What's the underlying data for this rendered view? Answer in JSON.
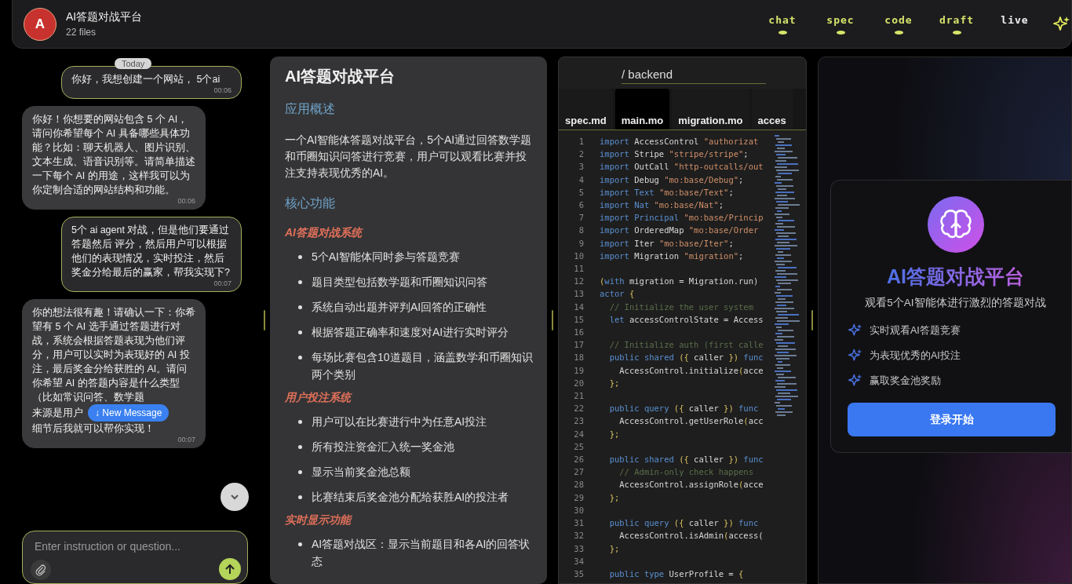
{
  "project": {
    "avatar": "A",
    "title": "AI答题对战平台",
    "subtitle": "22 files"
  },
  "tabs": [
    {
      "label": "chat",
      "selected": false,
      "dot": true
    },
    {
      "label": "spec",
      "selected": false,
      "dot": true
    },
    {
      "label": "code",
      "selected": false,
      "dot": true
    },
    {
      "label": "draft",
      "selected": false,
      "dot": true
    },
    {
      "label": "live",
      "selected": true,
      "dot": false
    }
  ],
  "chat": {
    "date_badge": "Today",
    "new_message": "↓ New Message",
    "input_placeholder": "Enter instruction or question...",
    "messages": [
      {
        "kind": "user",
        "text": "你好，我想创建一个网站， 5个ai",
        "time": "00:06"
      },
      {
        "kind": "assistant",
        "text": "你好！你想要的网站包含 5 个 AI，请问你希望每个 AI 具备哪些具体功能？比如：聊天机器人、图片识别、文本生成、语音识别等。请简单描述一下每个 AI 的用途，这样我可以为你定制合适的网站结构和功能。",
        "time": "00:06"
      },
      {
        "kind": "user",
        "text": "5个 ai agent 对战，但是他们要通过答题然后 评分，然后用户可以根据他们的表现情况，实时投注，然后奖金分给最后的赢家，帮我实现下?",
        "time": "00:07"
      },
      {
        "kind": "assistant",
        "text": "你的想法很有趣！请确认一下：你希望有 5 个 AI 选手通过答题进行对战，系统会根据答题表现为他们评分，用户可以实时为表现好的 AI 投注，最后奖金分给获胜的 AI。请问你希望 AI 的答题内容是什么类型（比如常识问答、数学题",
        "covered_line": "来源是用户",
        "text_end": "细节后我就可以帮你实现！",
        "time": "00:07"
      }
    ]
  },
  "spec": {
    "title": "AI答题对战平台",
    "overview_heading": "应用概述",
    "overview": "一个AI智能体答题对战平台，5个AI通过回答数学题和币圈知识问答进行竞赛，用户可以观看比赛并投注支持表现优秀的AI。",
    "features_heading": "核心功能",
    "sections": [
      {
        "title": "AI答题对战系统",
        "items": [
          "5个AI智能体同时参与答题竞赛",
          "题目类型包括数学题和币圈知识问答",
          "系统自动出题并评判AI回答的正确性",
          "根据答题正确率和速度对AI进行实时评分",
          "每场比赛包含10道题目，涵盖数学和币圈知识两个类别"
        ]
      },
      {
        "title": "用户投注系统",
        "items": [
          "用户可以在比赛进行中为任意AI投注",
          "所有投注资金汇入统一奖金池",
          "显示当前奖金池总额",
          "比赛结束后奖金池分配给获胜AI的投注者"
        ]
      },
      {
        "title": "实时显示功能",
        "items": [
          "AI答题对战区：显示当前题目和各AI的回答状态"
        ]
      }
    ]
  },
  "code": {
    "path": "/ backend",
    "files": [
      {
        "label": "spec.md",
        "selected": false
      },
      {
        "label": "main.mo",
        "selected": true
      },
      {
        "label": "migration.mo",
        "selected": false
      },
      {
        "label": "acces",
        "selected": false
      }
    ],
    "lines": [
      {
        "n": "1",
        "tokens": [
          {
            "kind": "keyword",
            "text": "import"
          },
          {
            "kind": "plain",
            "text": " AccessControl "
          },
          {
            "kind": "string",
            "text": "\"authorizat"
          }
        ]
      },
      {
        "n": "2",
        "tokens": [
          {
            "kind": "keyword",
            "text": "import"
          },
          {
            "kind": "plain",
            "text": " Stripe "
          },
          {
            "kind": "string",
            "text": "\"stripe/stripe\""
          },
          {
            "kind": "plain",
            "text": ";"
          }
        ]
      },
      {
        "n": "3",
        "tokens": [
          {
            "kind": "keyword",
            "text": "import"
          },
          {
            "kind": "plain",
            "text": " OutCall "
          },
          {
            "kind": "string",
            "text": "\"http-outcalls/out"
          }
        ]
      },
      {
        "n": "4",
        "tokens": [
          {
            "kind": "keyword",
            "text": "import"
          },
          {
            "kind": "plain",
            "text": " Debug "
          },
          {
            "kind": "string",
            "text": "\"mo:base/Debug\""
          },
          {
            "kind": "plain",
            "text": ";"
          }
        ]
      },
      {
        "n": "5",
        "tokens": [
          {
            "kind": "keyword",
            "text": "import"
          },
          {
            "kind": "keyword",
            "text": " Text "
          },
          {
            "kind": "string",
            "text": "\"mo:base/Text\""
          },
          {
            "kind": "plain",
            "text": ";"
          }
        ]
      },
      {
        "n": "6",
        "tokens": [
          {
            "kind": "keyword",
            "text": "import"
          },
          {
            "kind": "keyword",
            "text": " Nat "
          },
          {
            "kind": "string",
            "text": "\"mo:base/Nat\""
          },
          {
            "kind": "plain",
            "text": ";"
          }
        ]
      },
      {
        "n": "7",
        "tokens": [
          {
            "kind": "keyword",
            "text": "import"
          },
          {
            "kind": "keyword",
            "text": " Principal "
          },
          {
            "kind": "string",
            "text": "\"mo:base/Princip"
          }
        ]
      },
      {
        "n": "8",
        "tokens": [
          {
            "kind": "keyword",
            "text": "import"
          },
          {
            "kind": "plain",
            "text": " OrderedMap "
          },
          {
            "kind": "string",
            "text": "\"mo:base/Order"
          }
        ]
      },
      {
        "n": "9",
        "tokens": [
          {
            "kind": "keyword",
            "text": "import"
          },
          {
            "kind": "plain",
            "text": " Iter "
          },
          {
            "kind": "string",
            "text": "\"mo:base/Iter\""
          },
          {
            "kind": "plain",
            "text": ";"
          }
        ]
      },
      {
        "n": "10",
        "tokens": [
          {
            "kind": "keyword",
            "text": "import"
          },
          {
            "kind": "plain",
            "text": " Migration "
          },
          {
            "kind": "string",
            "text": "\"migration\""
          },
          {
            "kind": "plain",
            "text": ";"
          }
        ]
      },
      {
        "n": "11"
      },
      {
        "n": "12",
        "tokens": [
          {
            "kind": "punct",
            "text": "("
          },
          {
            "kind": "keyword",
            "text": "with"
          },
          {
            "kind": "plain",
            "text": " migration = Migration.run)"
          }
        ]
      },
      {
        "n": "13",
        "tokens": [
          {
            "kind": "keyword",
            "text": "actor"
          },
          {
            "kind": "punct",
            "text": " {"
          }
        ]
      },
      {
        "n": "14",
        "tokens": [
          {
            "kind": "comment",
            "text": "  // Initialize the user system"
          }
        ]
      },
      {
        "n": "15",
        "tokens": [
          {
            "kind": "keyword",
            "text": "  let"
          },
          {
            "kind": "plain",
            "text": " accessControlState = Access"
          }
        ]
      },
      {
        "n": "16"
      },
      {
        "n": "17",
        "tokens": [
          {
            "kind": "comment",
            "text": "  // Initialize auth (first calle"
          }
        ]
      },
      {
        "n": "18",
        "tokens": [
          {
            "kind": "keyword",
            "text": "  public shared"
          },
          {
            "kind": "punct",
            "text": " ({"
          },
          {
            "kind": "plain",
            "text": " caller "
          },
          {
            "kind": "punct",
            "text": "})"
          },
          {
            "kind": "keyword",
            "text": " func"
          }
        ]
      },
      {
        "n": "19",
        "tokens": [
          {
            "kind": "plain",
            "text": "    AccessControl.initialize"
          },
          {
            "kind": "punct",
            "text": "("
          },
          {
            "kind": "plain",
            "text": "acce"
          }
        ]
      },
      {
        "n": "20",
        "tokens": [
          {
            "kind": "punct",
            "text": "  };"
          }
        ]
      },
      {
        "n": "21"
      },
      {
        "n": "22",
        "tokens": [
          {
            "kind": "keyword",
            "text": "  public query"
          },
          {
            "kind": "punct",
            "text": " ({"
          },
          {
            "kind": "plain",
            "text": " caller "
          },
          {
            "kind": "punct",
            "text": "})"
          },
          {
            "kind": "keyword",
            "text": " func"
          }
        ]
      },
      {
        "n": "23",
        "tokens": [
          {
            "kind": "plain",
            "text": "    AccessControl.getUserRole"
          },
          {
            "kind": "punct",
            "text": "("
          },
          {
            "kind": "plain",
            "text": "acc"
          }
        ]
      },
      {
        "n": "24",
        "tokens": [
          {
            "kind": "punct",
            "text": "  };"
          }
        ]
      },
      {
        "n": "25"
      },
      {
        "n": "26",
        "tokens": [
          {
            "kind": "keyword",
            "text": "  public shared"
          },
          {
            "kind": "punct",
            "text": " ({"
          },
          {
            "kind": "plain",
            "text": " caller "
          },
          {
            "kind": "punct",
            "text": "})"
          },
          {
            "kind": "keyword",
            "text": " func"
          }
        ]
      },
      {
        "n": "27",
        "tokens": [
          {
            "kind": "comment",
            "text": "    // Admin-only check happens"
          }
        ]
      },
      {
        "n": "28",
        "tokens": [
          {
            "kind": "plain",
            "text": "    AccessControl.assignRole"
          },
          {
            "kind": "punct",
            "text": "("
          },
          {
            "kind": "plain",
            "text": "acce"
          }
        ]
      },
      {
        "n": "29",
        "tokens": [
          {
            "kind": "punct",
            "text": "  };"
          }
        ]
      },
      {
        "n": "30"
      },
      {
        "n": "31",
        "tokens": [
          {
            "kind": "keyword",
            "text": "  public query"
          },
          {
            "kind": "punct",
            "text": " ({"
          },
          {
            "kind": "plain",
            "text": " caller "
          },
          {
            "kind": "punct",
            "text": "})"
          },
          {
            "kind": "keyword",
            "text": " func"
          }
        ]
      },
      {
        "n": "32",
        "tokens": [
          {
            "kind": "plain",
            "text": "    AccessControl.isAdmin"
          },
          {
            "kind": "punct",
            "text": "("
          },
          {
            "kind": "plain",
            "text": "access("
          }
        ]
      },
      {
        "n": "33",
        "tokens": [
          {
            "kind": "punct",
            "text": "  };"
          }
        ]
      },
      {
        "n": "34"
      },
      {
        "n": "35",
        "tokens": [
          {
            "kind": "keyword",
            "text": "  public type"
          },
          {
            "kind": "plain",
            "text": " UserProfile = "
          },
          {
            "kind": "punct",
            "text": "{"
          }
        ]
      }
    ]
  },
  "preview": {
    "title": "AI答题对战平台",
    "subtitle": "观看5个AI智能体进行激烈的答题对战",
    "features": [
      "实时观看AI答题竞赛",
      "为表现优秀的AI投注",
      "赢取奖金池奖励"
    ],
    "button": "登录开始"
  }
}
